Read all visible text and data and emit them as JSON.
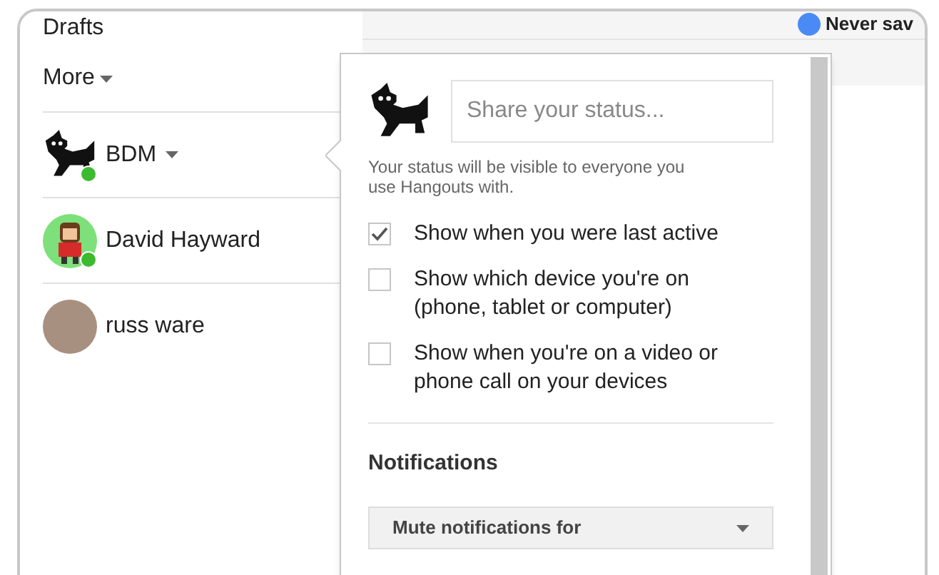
{
  "nav": [
    {
      "label": "Drafts",
      "has_menu": false
    },
    {
      "label": "More",
      "has_menu": true
    }
  ],
  "contacts": [
    {
      "name": "BDM",
      "kind": "dog",
      "online": true,
      "has_menu": true
    },
    {
      "name": "David Hayward",
      "kind": "cartoon",
      "online": true,
      "has_menu": false
    },
    {
      "name": "russ ware",
      "kind": "photo",
      "online": false,
      "has_menu": false
    }
  ],
  "top_option": {
    "label": "Never sav",
    "checked": true
  },
  "status_popup": {
    "status_field": {
      "placeholder": "Share your status..."
    },
    "note": "Your status will be visible to everyone you use Hangouts with.",
    "options": [
      {
        "label": "Show when you were last active",
        "checked": true
      },
      {
        "label": "Show which device you're on (phone, tablet or computer)",
        "checked": false
      },
      {
        "label": "Show when you're on a video or phone call on your devices",
        "checked": false
      }
    ],
    "notifications": {
      "heading": "Notifications",
      "mute_select": "Mute notifications for"
    }
  }
}
